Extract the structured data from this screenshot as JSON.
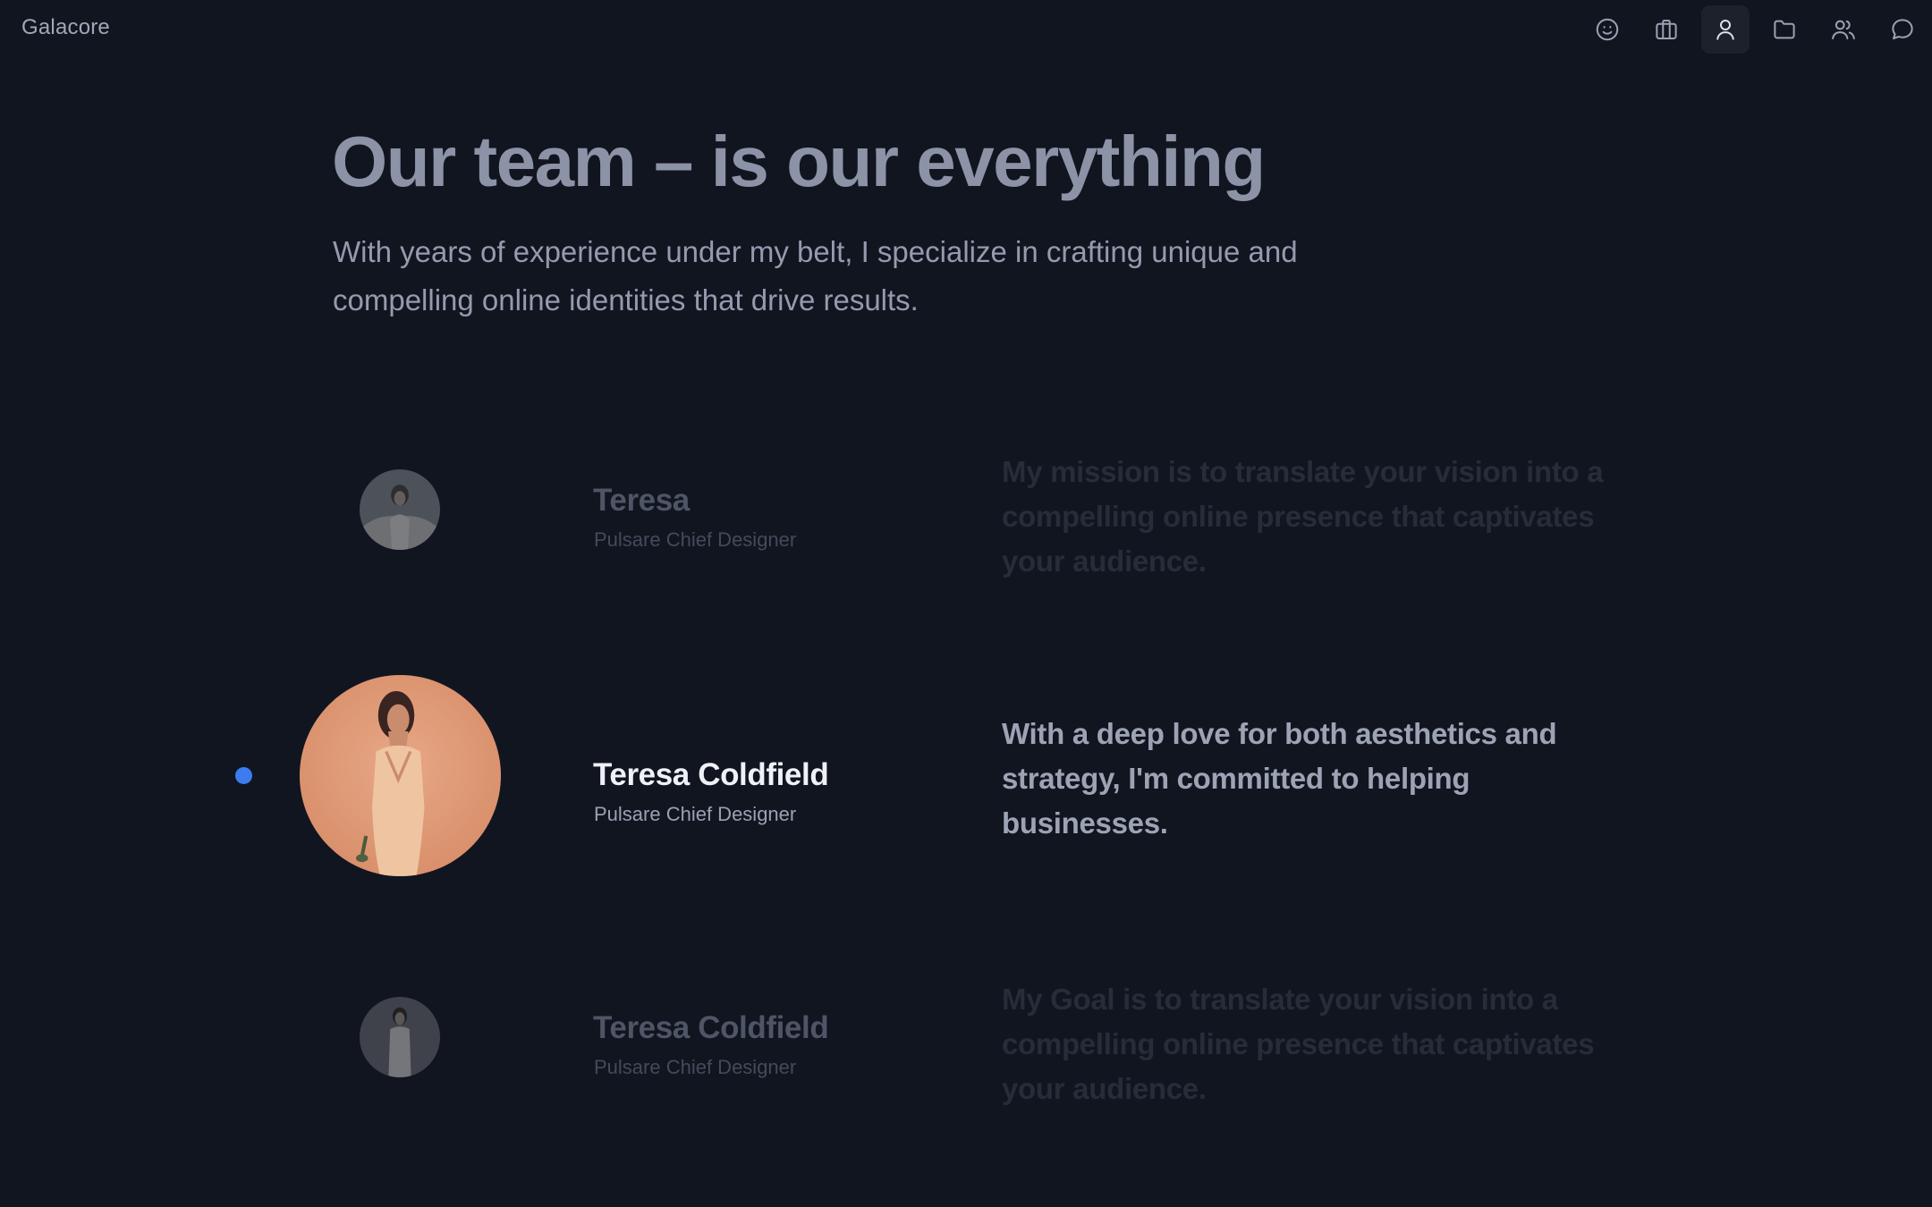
{
  "brand": "Galacore",
  "nav": [
    {
      "icon": "smile-icon",
      "active": false
    },
    {
      "icon": "briefcase-icon",
      "active": false
    },
    {
      "icon": "user-icon",
      "active": true
    },
    {
      "icon": "folder-icon",
      "active": false
    },
    {
      "icon": "users-icon",
      "active": false
    },
    {
      "icon": "message-icon",
      "active": false
    }
  ],
  "hero": {
    "title": "Our team – is our everything",
    "subtitle": "With years of experience under my belt, I specialize in crafting unique and compelling online identities that drive results."
  },
  "members": [
    {
      "name": "Teresa",
      "role": "Pulsare Chief Designer",
      "quote": "My mission is to translate your vision into a compelling online presence that captivates your audience.",
      "active": false
    },
    {
      "name": "Teresa Coldfield",
      "role": "Pulsare Chief Designer",
      "quote": "With a deep love for both aesthetics and strategy, I'm committed to helping businesses.",
      "active": true
    },
    {
      "name": "Teresa Coldfield",
      "role": "Pulsare Chief Designer",
      "quote": "My Goal is to translate your vision into a compelling online presence that captivates your audience.",
      "active": false
    }
  ],
  "colors": {
    "background": "#111520",
    "accent": "#3c7bf0",
    "active_name": "#eef1f6",
    "text_muted": "#949bae"
  }
}
